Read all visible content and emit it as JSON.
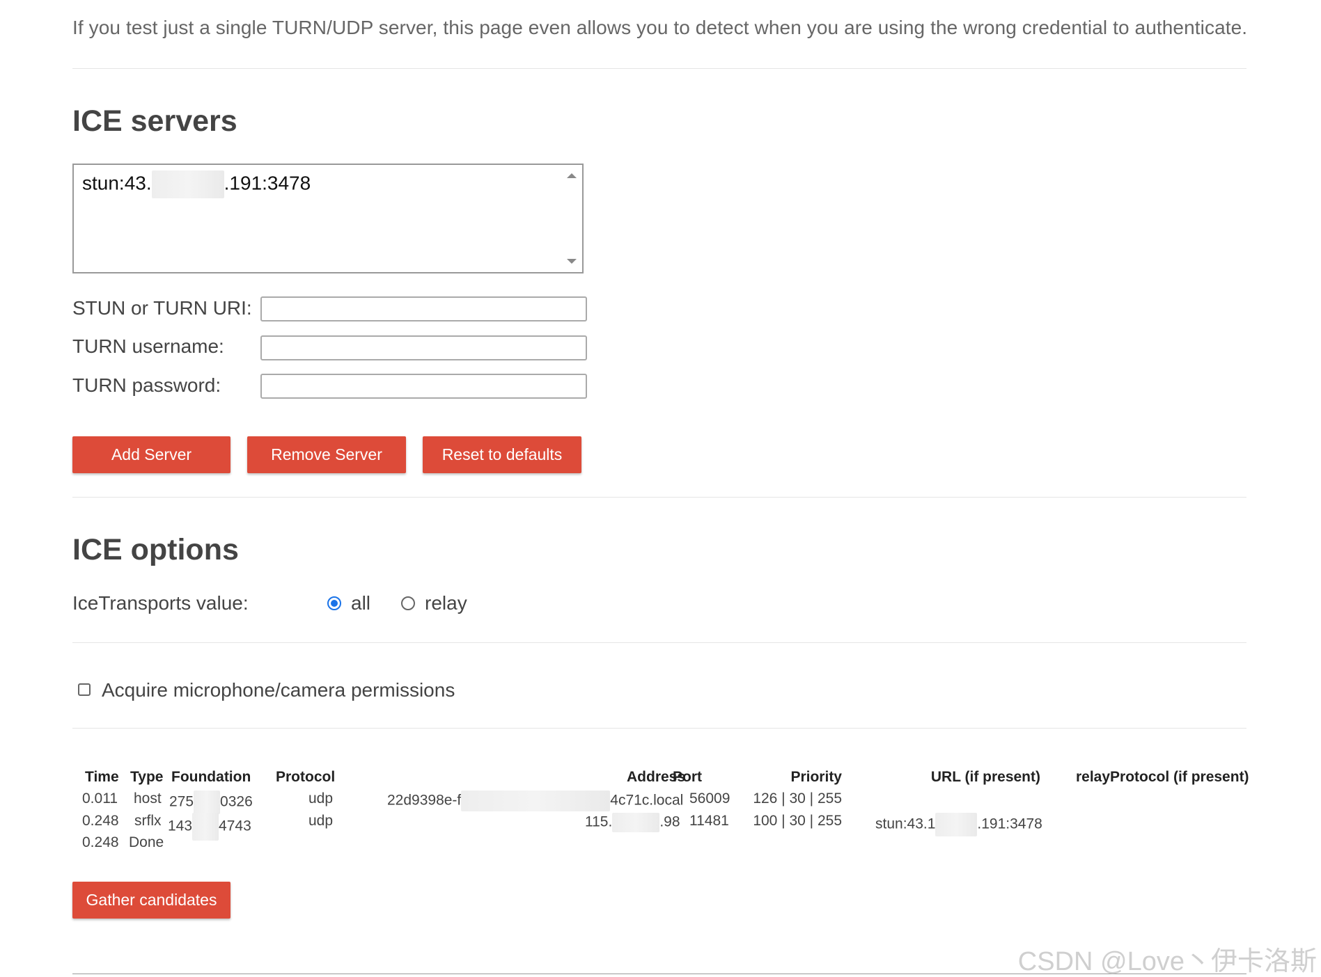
{
  "intro_text": "If you test just a single TURN/UDP server, this page even allows you to detect when you are using the wrong credential to authenticate.",
  "ice_servers": {
    "title": "ICE servers",
    "list_item_prefix": "stun:43.",
    "list_item_suffix": ".191:3478",
    "uri_label": "STUN or TURN URI:",
    "username_label": "TURN username:",
    "password_label": "TURN password:",
    "uri_value": "",
    "username_value": "",
    "password_value": "",
    "add_label": "Add Server",
    "remove_label": "Remove Server",
    "reset_label": "Reset to defaults"
  },
  "ice_options": {
    "title": "ICE options",
    "transports_label": "IceTransports value:",
    "options": [
      "all",
      "relay"
    ],
    "selected": "all",
    "permissions_label": "Acquire microphone/camera permissions",
    "permissions_checked": false
  },
  "candidates": {
    "headers": {
      "time": "Time",
      "type": "Type",
      "foundation": "Foundation",
      "protocol": "Protocol",
      "address": "Address",
      "port": "Port",
      "priority": "Priority",
      "url": "URL (if present)",
      "relay_protocol": "relayProtocol (if present)"
    },
    "rows": [
      {
        "time": "0.011",
        "type": "host",
        "foundation_prefix": "275",
        "foundation_suffix": "0326",
        "protocol": "udp",
        "address_prefix": "22d9398e-f",
        "address_suffix": "4c71c.local",
        "port": "56009",
        "priority": "126 | 30 | 255",
        "url_prefix": "",
        "url_suffix": ""
      },
      {
        "time": "0.248",
        "type": "srflx",
        "foundation_prefix": "143",
        "foundation_suffix": "4743",
        "protocol": "udp",
        "address_prefix": "115.",
        "address_suffix": ".98",
        "port": "11481",
        "priority": "100 | 30 | 255",
        "url_prefix": "stun:43.1",
        "url_suffix": ".191:3478"
      }
    ],
    "done_time": "0.248",
    "done_label": "Done",
    "gather_label": "Gather candidates"
  },
  "watermark": "CSDN @Love丶伊卡洛斯",
  "colors": {
    "button_bg": "#dd4b39",
    "radio_checked": "#1a73e8"
  }
}
